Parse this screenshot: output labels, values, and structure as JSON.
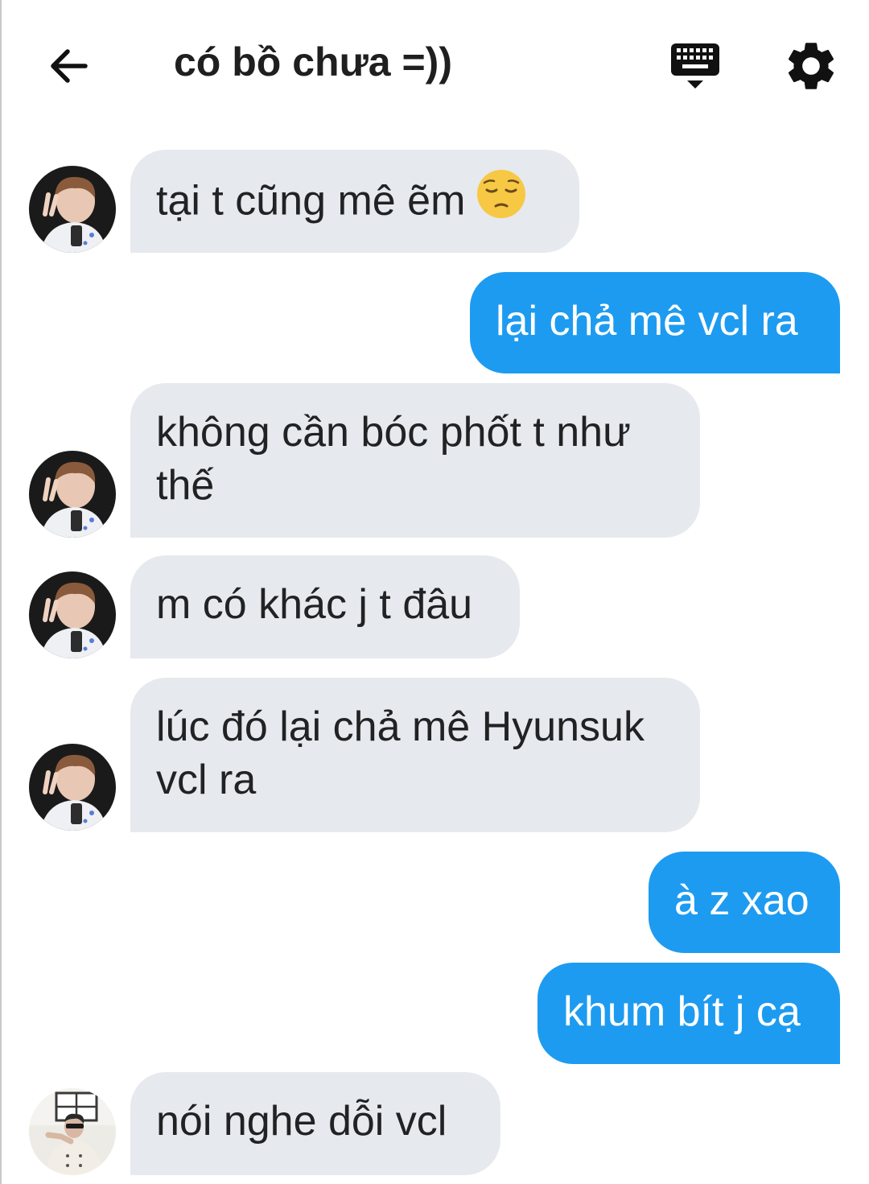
{
  "header": {
    "title": "có bồ chưa =))",
    "back_icon": "arrow-left-icon",
    "keyboard_icon": "keyboard-icon",
    "settings_icon": "gear-icon"
  },
  "colors": {
    "outgoing_bubble": "#1d9bf0",
    "incoming_bubble": "#e6e9ed"
  },
  "messages": [
    {
      "side": "incoming",
      "text": "tại t cũng mê ẽm",
      "emoji": "pensive-face"
    },
    {
      "side": "outgoing",
      "text": "lại chả mê vcl ra"
    },
    {
      "side": "incoming",
      "text": "không cần bóc phốt t như thế"
    },
    {
      "side": "incoming",
      "text": "m có khác j t đâu"
    },
    {
      "side": "incoming",
      "text": "lúc đó lại chả mê Hyunsuk vcl ra"
    },
    {
      "side": "outgoing",
      "text": "à z xao"
    },
    {
      "side": "outgoing",
      "text": "khum bít j cạ"
    },
    {
      "side": "incoming",
      "text": "nói nghe dỗi vcl"
    }
  ]
}
